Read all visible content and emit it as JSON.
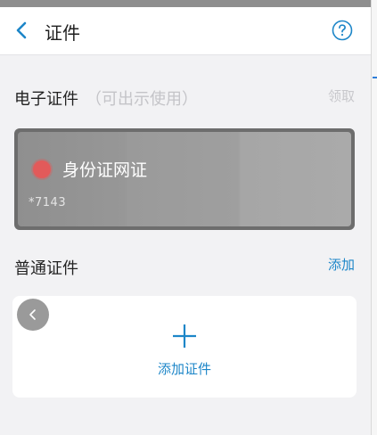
{
  "header": {
    "title": "证件"
  },
  "electronic": {
    "title": "电子证件",
    "note": "（可出示使用）",
    "claim_label": "领取",
    "card": {
      "name": "身份证网证",
      "number": "*7143",
      "status_color": "#e25a5a"
    }
  },
  "regular": {
    "title": "普通证件",
    "add_link": "添加",
    "add_button_label": "添加证件"
  },
  "icons": {
    "back": "chevron-left-icon",
    "help": "question-circle-icon",
    "plus": "plus-icon",
    "float_back": "chevron-left-icon"
  },
  "colors": {
    "accent": "#1d86c8",
    "background": "#f2f2f4"
  }
}
